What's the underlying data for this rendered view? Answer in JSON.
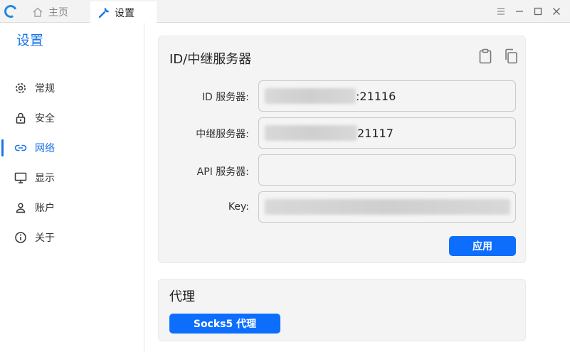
{
  "titlebar": {
    "tabs": [
      {
        "label": "主页",
        "icon": "home-icon"
      },
      {
        "label": "设置",
        "icon": "wrench-icon"
      }
    ],
    "controls": [
      "menu-icon",
      "minimize-icon",
      "maximize-icon",
      "close-icon"
    ]
  },
  "sidebar": {
    "title": "设置",
    "items": [
      {
        "label": "常规",
        "icon": "gear-icon"
      },
      {
        "label": "安全",
        "icon": "lock-icon"
      },
      {
        "label": "网络",
        "icon": "link-icon",
        "active": true
      },
      {
        "label": "显示",
        "icon": "monitor-icon"
      },
      {
        "label": "账户",
        "icon": "person-icon"
      },
      {
        "label": "关于",
        "icon": "info-icon"
      }
    ]
  },
  "server_card": {
    "title": "ID/中继服务器",
    "id_server": {
      "label": "ID 服务器:",
      "value": ":21116"
    },
    "relay_server": {
      "label": "中继服务器:",
      "value": "21117"
    },
    "api_server": {
      "label": "API 服务器:",
      "value": ""
    },
    "key": {
      "label": "Key:",
      "value": ""
    },
    "apply_label": "应用"
  },
  "proxy_card": {
    "title": "代理",
    "socks_label": "Socks5 代理"
  },
  "colors": {
    "accent": "#1a73e8",
    "button": "#0d6efd",
    "card": "#f4f4f4"
  }
}
